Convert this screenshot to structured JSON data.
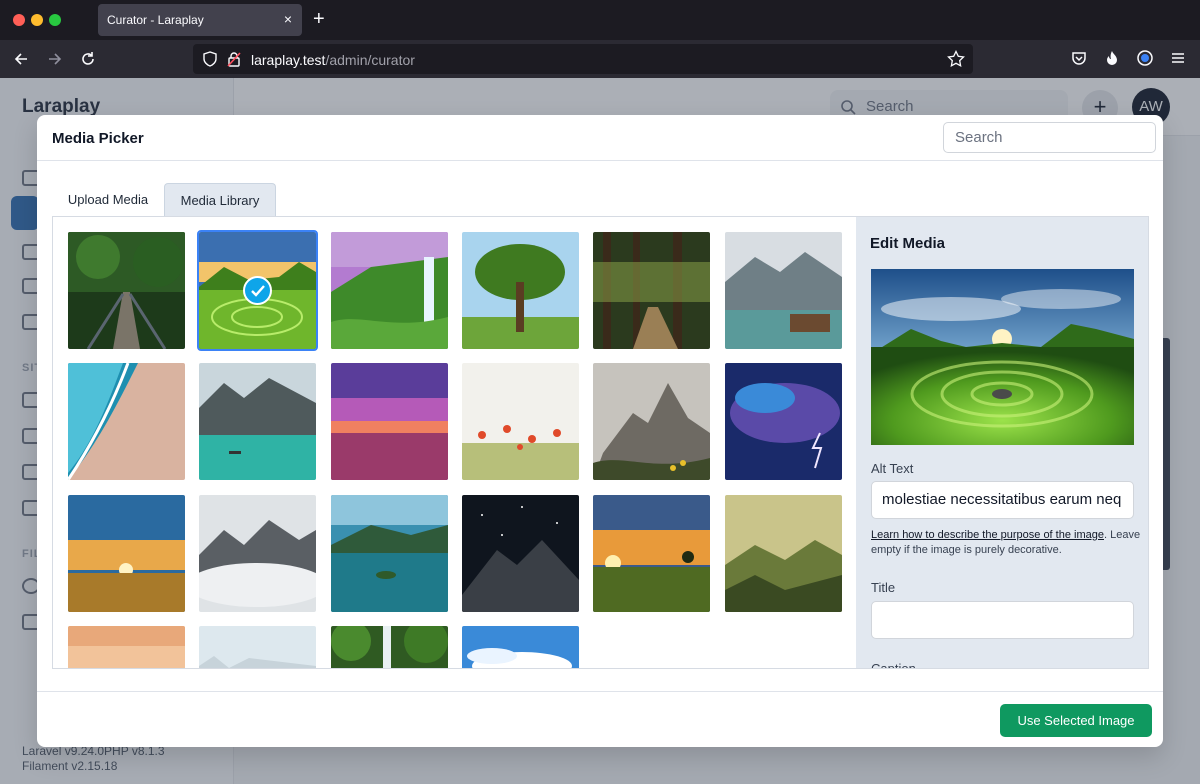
{
  "browser": {
    "tab_title": "Curator - Laraplay",
    "tab_close": "×",
    "new_tab": "+",
    "url_host": "laraplay.test",
    "url_path": "/admin/curator",
    "icons": [
      "back-icon",
      "forward-icon",
      "reload-icon",
      "shield-icon",
      "lock-icon",
      "star-icon",
      "pocket-icon",
      "flame-icon",
      "account-icon",
      "menu-icon"
    ]
  },
  "app": {
    "brand": "Laraplay",
    "search_placeholder": "Search",
    "plus": "+",
    "avatar_initials": "AW",
    "section_labels": [
      "SIT",
      "FIL"
    ],
    "footer_line1": "Laravel v9.24.0PHP v8.1.3",
    "footer_line2": "Filament v2.15.18"
  },
  "modal": {
    "title": "Media Picker",
    "search_placeholder": "Search",
    "tabs": [
      {
        "label": "Upload Media",
        "active": false
      },
      {
        "label": "Media Library",
        "active": true
      }
    ],
    "selected_index": 1,
    "images": [
      {
        "name": "forest-bridge"
      },
      {
        "name": "green-spiral-valley"
      },
      {
        "name": "waterfall-valley"
      },
      {
        "name": "lone-tree"
      },
      {
        "name": "forest-path"
      },
      {
        "name": "lake-boathouse"
      },
      {
        "name": "beach-waves"
      },
      {
        "name": "turquoise-lake"
      },
      {
        "name": "purple-sunset"
      },
      {
        "name": "poppy-field"
      },
      {
        "name": "misty-peaks"
      },
      {
        "name": "lightning-storm"
      },
      {
        "name": "field-sunset"
      },
      {
        "name": "cloudy-mountains"
      },
      {
        "name": "lake-island"
      },
      {
        "name": "starry-mountain"
      },
      {
        "name": "meadow-sunset"
      },
      {
        "name": "hazy-valley"
      },
      {
        "name": "peach-sky"
      },
      {
        "name": "pale-mountains"
      },
      {
        "name": "jungle-waterfall"
      },
      {
        "name": "blue-sky-clouds"
      }
    ],
    "edit": {
      "title": "Edit Media",
      "alt_label": "Alt Text",
      "alt_value": "molestiae necessitatibus earum neq",
      "help_link": "Learn how to describe the purpose of the image",
      "help_rest": ". Leave empty if the image is purely decorative.",
      "title_label": "Title",
      "title_value": "",
      "caption_label": "Caption"
    },
    "use_button": "Use Selected Image"
  }
}
